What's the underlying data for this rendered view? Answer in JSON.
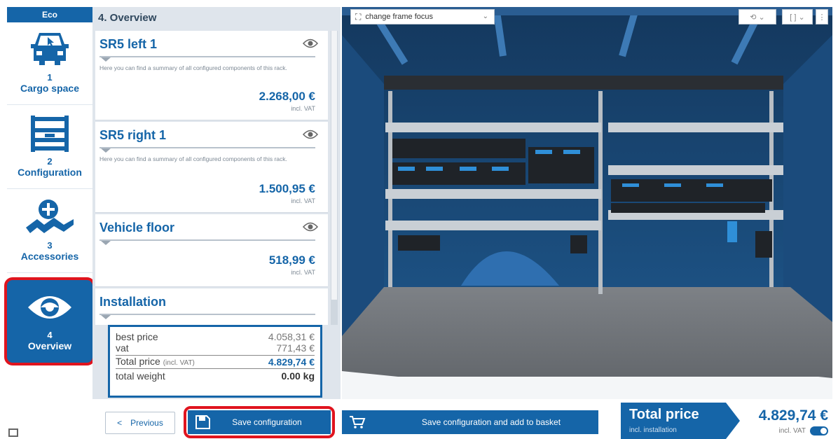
{
  "sidebar": {
    "mode_tag": "Eco",
    "steps": [
      {
        "number": "1",
        "label": "Cargo space",
        "icon": "van-cursor-icon"
      },
      {
        "number": "2",
        "label": "Configuration",
        "icon": "shelf-rack-icon"
      },
      {
        "number": "3",
        "label": "Accessories",
        "icon": "add-accessories-icon"
      },
      {
        "number": "4",
        "label": "Overview",
        "icon": "eye-icon"
      }
    ]
  },
  "panel": {
    "title": "4. Overview",
    "items": [
      {
        "name": "SR5 left 1",
        "description": "Here you can find a summary of all configured components of this rack.",
        "price": "2.268,00 €",
        "vat_note": "incl. VAT"
      },
      {
        "name": "SR5 right 1",
        "description": "Here you can find a summary of all configured components of this rack.",
        "price": "1.500,95 €",
        "vat_note": "incl. VAT"
      },
      {
        "name": "Vehicle floor",
        "description": "",
        "price": "518,99 €",
        "vat_note": "incl. VAT"
      },
      {
        "name": "Installation"
      }
    ],
    "summary": {
      "best_price_label": "best price",
      "best_price_value": "4.058,31 €",
      "vat_label": "vat",
      "vat_value": "771,43 €",
      "total_label": "Total price",
      "total_label_small": "(incl. VAT)",
      "total_value": "4.829,74 €",
      "weight_label": "total weight",
      "weight_value": "0.00 kg"
    }
  },
  "footer": {
    "previous_label": "Previous",
    "previous_prefix": "<",
    "save_label": "Save configuration",
    "save_basket_label": "Save configuration and add to basket",
    "total_title": "Total price",
    "total_subtitle": "incl. installation",
    "total_value": "4.829,74 €",
    "total_vat": "incl. VAT"
  },
  "viewport": {
    "frame_focus_label": "change frame focus"
  },
  "colors": {
    "accent": "#1565a8",
    "highlight": "#e0141e",
    "panel_bg": "#dfe5ec"
  }
}
